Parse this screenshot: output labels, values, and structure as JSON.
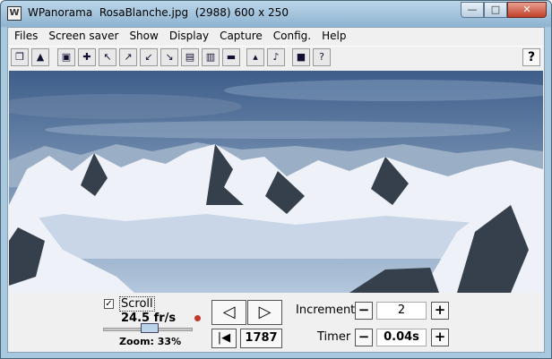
{
  "window": {
    "title": "WPanorama  RosaBlanche.jpg  (2988) 600 x 250",
    "minimize_glyph": "—",
    "maximize_glyph": "□",
    "close_glyph": "✕",
    "app_icon_glyph": "W"
  },
  "menu": {
    "items": [
      {
        "label": "Files"
      },
      {
        "label": "Screen saver"
      },
      {
        "label": "Show"
      },
      {
        "label": "Display"
      },
      {
        "label": "Capture"
      },
      {
        "label": "Config."
      },
      {
        "label": "Help"
      }
    ]
  },
  "toolbar": {
    "buttons": [
      {
        "name": "open-file-icon",
        "glyph": "❐"
      },
      {
        "name": "picture-icon",
        "glyph": "▲"
      },
      {
        "name": "fullscreen-icon",
        "glyph": "▣"
      },
      {
        "name": "move-arrows-icon",
        "glyph": "✚"
      },
      {
        "name": "shrink-left-icon",
        "glyph": "↖"
      },
      {
        "name": "expand-right-icon",
        "glyph": "↗"
      },
      {
        "name": "shrink-bottom-icon",
        "glyph": "↙"
      },
      {
        "name": "expand-bottom-icon",
        "glyph": "↘"
      },
      {
        "name": "fit-window-icon",
        "glyph": "▤"
      },
      {
        "name": "fit-height-icon",
        "glyph": "▥"
      },
      {
        "name": "fit-width-icon",
        "glyph": "▬"
      },
      {
        "name": "flatten-icon",
        "glyph": "▴"
      },
      {
        "name": "sound-icon",
        "glyph": "♪"
      },
      {
        "name": "book-icon",
        "glyph": "■"
      },
      {
        "name": "context-help-icon",
        "glyph": "?"
      }
    ],
    "help_glyph": "?"
  },
  "colors": {
    "sky_top": "#3e5e8a",
    "sky_bottom": "#b3c7dc",
    "snow": "#eef2f8",
    "rock": "#36404c",
    "valley": "#c8d6e8"
  },
  "controls": {
    "scroll_label": "Scroll",
    "scroll_checked": true,
    "scroll_check_glyph": "✓",
    "fps_text": "24.5 fr/s",
    "zoom_text": "Zoom: 33%",
    "zoom_fraction": 0.33,
    "prev_glyph": "◁",
    "next_glyph": "▷",
    "first_glyph": "|◀",
    "position_value": "1787",
    "increment_label": "Increment",
    "increment_value": "2",
    "timer_label": "Timer",
    "timer_value": "0.04s",
    "minus_glyph": "−",
    "plus_glyph": "+"
  }
}
